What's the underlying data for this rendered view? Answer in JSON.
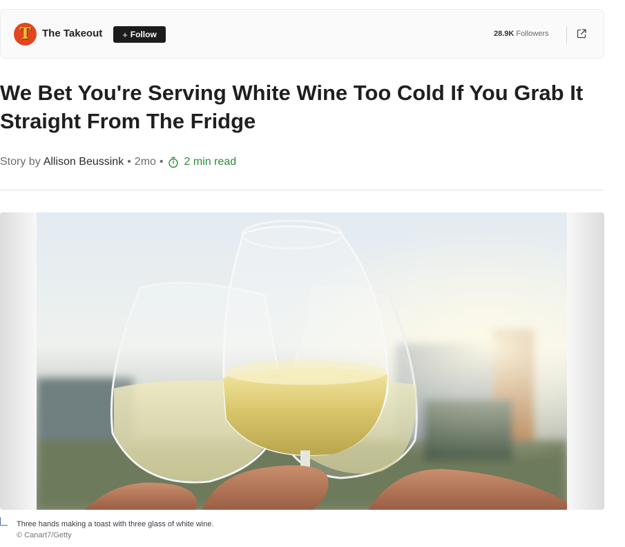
{
  "publisher": {
    "name": "The Takeout",
    "logo_letter": "T",
    "follow_label": "Follow",
    "followers_count": "28.9K",
    "followers_label": "Followers",
    "logo_color": "#e2461f"
  },
  "article": {
    "headline": "We Bet You're Serving White Wine Too Cold If You Grab It Straight From The Fridge",
    "byline_prefix": "Story by",
    "author": "Allison Beussink",
    "age": "2mo",
    "read_time": "2 min read",
    "read_time_color": "#258d39"
  },
  "image": {
    "alt": "Three hands making a toast with three glass of white wine.",
    "caption": "Three hands making a toast with three glass of white wine.",
    "credit": "© Canart7/Getty"
  },
  "icons": {
    "share": "share-external-icon",
    "timer": "stopwatch-icon",
    "plus": "plus-icon"
  }
}
